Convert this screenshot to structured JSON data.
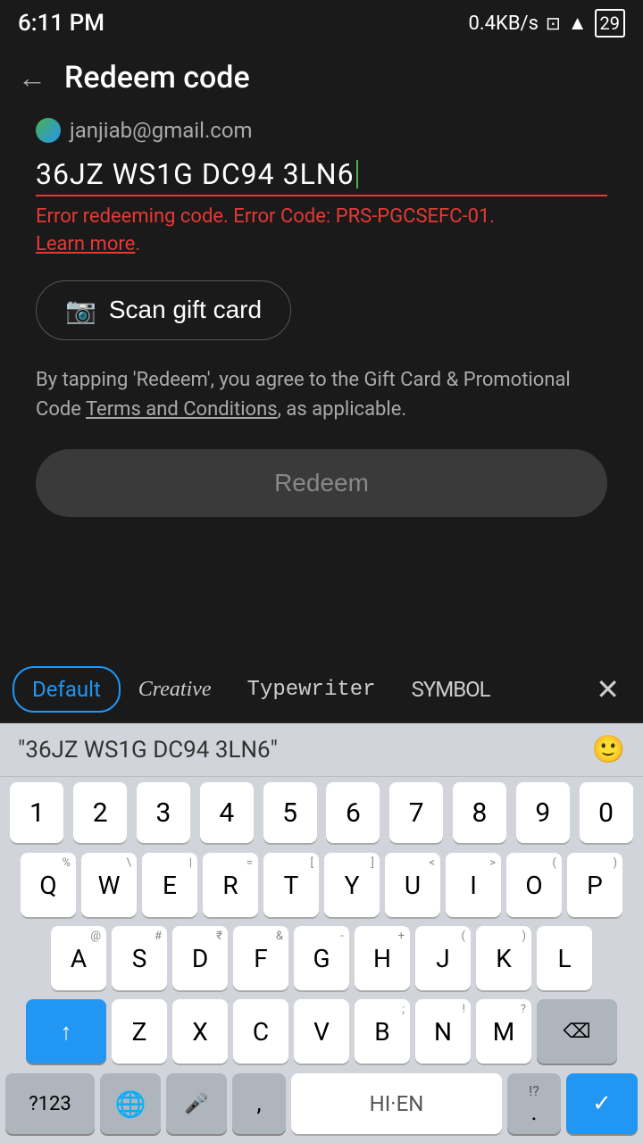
{
  "statusBar": {
    "time": "6:11 PM",
    "network": "0.4KB/s",
    "battery": "29"
  },
  "header": {
    "title": "Redeem code",
    "backLabel": "←"
  },
  "email": "janjiab@gmail.com",
  "codeInput": {
    "value": "36JZ WS1G DC94 3LN6",
    "placeholder": ""
  },
  "error": {
    "message": "Error redeeming code. Error Code: PRS-PGCSEFC-01.",
    "learnMore": "Learn more"
  },
  "scanButton": {
    "label": "Scan gift card"
  },
  "terms": {
    "prefix": "By tapping 'Redeem', you agree to the Gift Card & Promotional Code ",
    "link": "Terms and Conditions",
    "suffix": ", as applicable."
  },
  "redeemButton": {
    "label": "Redeem"
  },
  "keyboard": {
    "tabs": [
      {
        "id": "default",
        "label": "Default",
        "active": true
      },
      {
        "id": "creative",
        "label": "Creative"
      },
      {
        "id": "typewriter",
        "label": "Typewriter"
      },
      {
        "id": "symbol",
        "label": "SYMBOL"
      }
    ],
    "suggestion": "\"36JZ WS1G DC94 3LN6\"",
    "emojiLabel": "🙂",
    "closeLabel": "✕",
    "rows": {
      "numbers": [
        "1",
        "2",
        "3",
        "4",
        "5",
        "6",
        "7",
        "8",
        "9",
        "0"
      ],
      "row1": [
        "Q",
        "W",
        "E",
        "R",
        "T",
        "Y",
        "U",
        "I",
        "O",
        "P"
      ],
      "row2": [
        "A",
        "S",
        "D",
        "F",
        "G",
        "H",
        "J",
        "K",
        "L"
      ],
      "row3": [
        "Z",
        "X",
        "C",
        "V",
        "B",
        "N",
        "M"
      ],
      "secondaries": {
        "Q": "%",
        "W": "\\",
        "E": "|",
        "R": "=",
        "T": "[",
        "Y": "]",
        "U": "<",
        "I": ">",
        "O": "(",
        "P": ")",
        "A": "@",
        "S": "#",
        "D": "₹",
        "F": "&",
        "G": "-",
        "H": "+",
        "J": "(",
        "K": ")",
        "L": ")",
        "Z": "",
        "X": "",
        "C": "",
        "V": "",
        "B": ";",
        "N": "!",
        "M": "?"
      }
    },
    "bottomRow": {
      "num123": "?123",
      "globeLabel": "🌐",
      "micLabel": "🎤",
      "commaLabel": ",",
      "spaceLabel": "HI·EN",
      "periodLabel": ".",
      "punctLabel": "!?"
    }
  }
}
